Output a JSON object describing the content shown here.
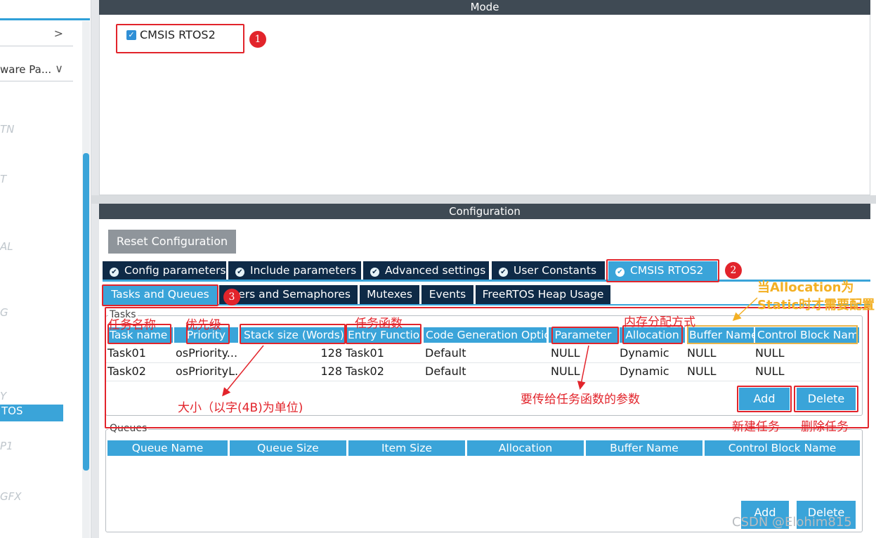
{
  "sidebar": {
    "row1_label": "",
    "row1_chevron": ">",
    "row2_label": "ware Pa...",
    "row2_chevron": "∨",
    "categories": [
      "TN",
      "T",
      "AL",
      "G",
      "Y",
      "P1",
      "GFX"
    ],
    "selected_item": "TOS"
  },
  "mode": {
    "header": "Mode",
    "checkbox_label": "CMSIS RTOS2",
    "checkbox_checked": true
  },
  "configuration": {
    "header": "Configuration",
    "reset_button": "Reset Configuration",
    "tabs": [
      "Config parameters",
      "Include parameters",
      "Advanced settings",
      "User Constants",
      "CMSIS RTOS2"
    ],
    "active_tab": "CMSIS RTOS2",
    "subtabs": [
      "Tasks and Queues",
      "ners and Semaphores",
      "Mutexes",
      "Events",
      "FreeRTOS Heap Usage"
    ],
    "active_subtab": "Tasks and Queues"
  },
  "tasks": {
    "legend": "Tasks",
    "columns": [
      "Task name",
      "Priority",
      "Stack size (Words)",
      "Entry Functio",
      "Code Generation Option",
      "Parameter",
      "Allocation",
      "Buffer Name",
      "Control Block Name"
    ],
    "rows": [
      [
        "Task01",
        "osPriority...",
        "128",
        "Task01",
        "Default",
        "NULL",
        "Dynamic",
        "NULL",
        "NULL"
      ],
      [
        "Task02",
        "osPriorityL...",
        "128",
        "Task02",
        "Default",
        "NULL",
        "Dynamic",
        "NULL",
        "NULL"
      ]
    ],
    "add_button": "Add",
    "delete_button": "Delete"
  },
  "queues": {
    "legend": "Queues",
    "columns": [
      "Queue Name",
      "Queue Size",
      "Item Size",
      "Allocation",
      "Buffer Name",
      "Control Block Name"
    ],
    "add_button": "Add",
    "delete_button": "Delete"
  },
  "annotations": {
    "badges": [
      "1",
      "2",
      "3"
    ],
    "task_name_note": "任务名称",
    "priority_note": "优先级",
    "entry_note": "任务函数",
    "alloc_note": "内存分配方式",
    "stack_note": "大小（以字(4B)为单位)",
    "param_note": "要传给任务函数的参数",
    "add_note": "新建任务",
    "delete_note": "删除任务",
    "static_note_line1": "当Allocation为",
    "static_note_line2": "Static时才需要配置"
  },
  "watermark": "CSDN @Elohim815",
  "colors": {
    "accent_blue": "#3aa4d9",
    "tab_navy": "#0e2a47",
    "header_gray": "#3f4a54",
    "annotation_red": "#e2242b",
    "annotation_orange": "#f3b024"
  }
}
